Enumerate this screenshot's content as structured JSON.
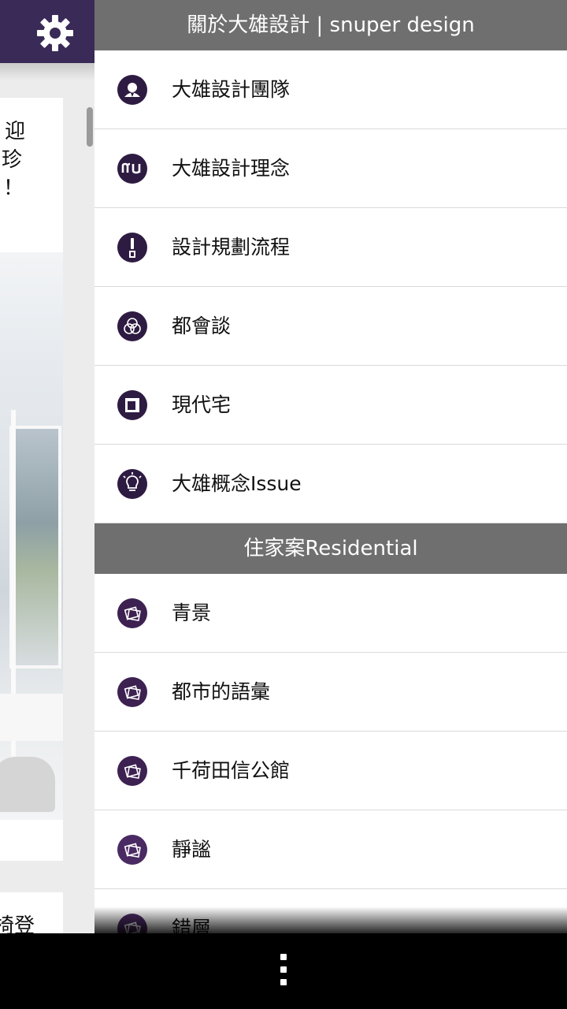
{
  "background_app": {
    "card_text_lines": [
      "迎",
      "珍",
      "！"
    ],
    "bottom_card_text": "椅登"
  },
  "drawer": {
    "title": "關於大雄設計 | snuper design",
    "about_items": [
      {
        "label": "大雄設計團隊",
        "icon": "person-icon"
      },
      {
        "label": "大雄設計理念",
        "icon": "nu-logo-icon"
      },
      {
        "label": "設計規劃流程",
        "icon": "exclamation-icon"
      },
      {
        "label": "都會談",
        "icon": "circles-icon"
      },
      {
        "label": "現代宅",
        "icon": "square-icon"
      },
      {
        "label": "大雄概念Issue",
        "icon": "lightbulb-icon"
      }
    ],
    "section_residential": "住家案Residential",
    "residential_items": [
      {
        "label": "青景",
        "icon": "photos-icon"
      },
      {
        "label": "都市的語彙",
        "icon": "photos-icon"
      },
      {
        "label": "千荷田信公館",
        "icon": "photos-icon"
      },
      {
        "label": "靜謐",
        "icon": "photos-icon"
      },
      {
        "label": "錯層",
        "icon": "photos-icon"
      }
    ]
  },
  "colors": {
    "topbar": "#3a2a57",
    "header_gray": "#6f6f6f",
    "icon_purple": "#2e1b42"
  }
}
